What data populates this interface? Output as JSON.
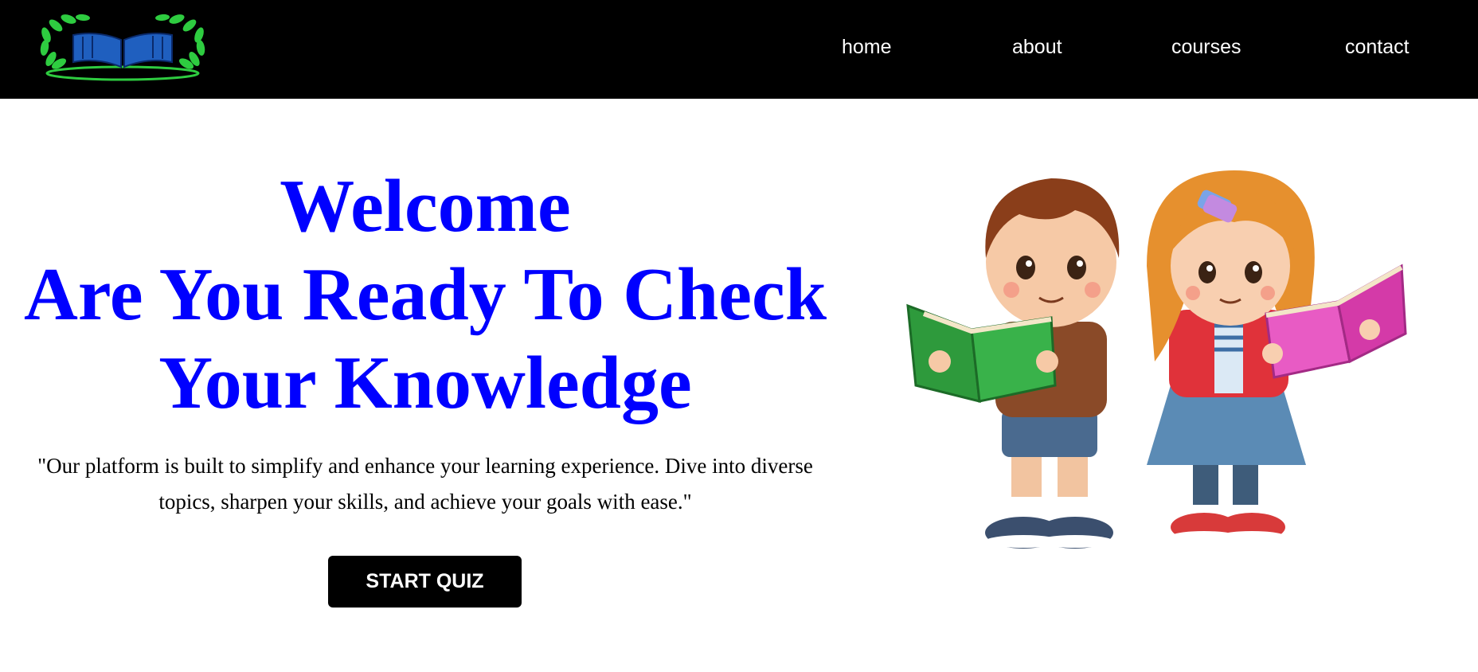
{
  "header": {
    "logo_icon": "laurel-book-logo-icon",
    "nav": [
      {
        "label": "home"
      },
      {
        "label": "about"
      },
      {
        "label": "courses"
      },
      {
        "label": "contact"
      }
    ]
  },
  "hero": {
    "headline_lines": [
      "Welcome",
      "Are You Ready To Check",
      "Your Knowledge"
    ],
    "tagline": "\"Our platform is built to simplify and enhance your learning experience. Dive into diverse topics, sharpen your skills, and achieve your goals with ease.\"",
    "cta_label": "START QUIZ",
    "illustration_icon": "kids-reading-books-illustration"
  },
  "colors": {
    "nav_background": "#000000",
    "headline": "#0000ff",
    "button": "#000000",
    "logo_laurel": "#2ecc40",
    "logo_book": "#1f5fbf"
  }
}
